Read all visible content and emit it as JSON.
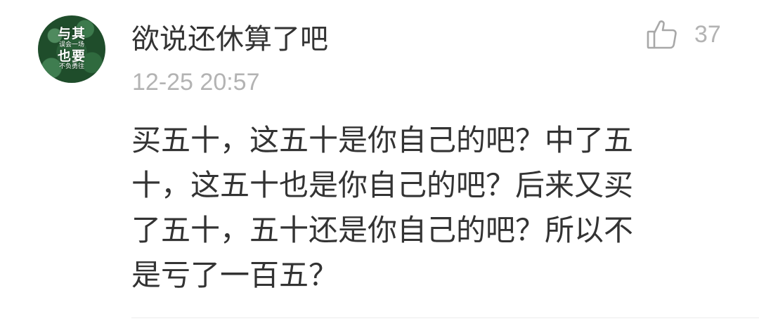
{
  "comment": {
    "avatar": {
      "line1": "与其",
      "line2": "误会一场",
      "line3": "也要",
      "line4": "不负勇往"
    },
    "username": "欲说还休算了吧",
    "timestamp": "12-25 20:57",
    "like": {
      "icon": "thumbs-up-icon",
      "count": "37"
    },
    "content_lines": [
      "买五十，这五十是你自己的吧？中了五",
      "十，这五十也是你自己的吧？后来又买",
      "了五十，五十还是你自己的吧？所以不",
      "是亏了一百五？"
    ]
  },
  "colors": {
    "text_primary": "#333333",
    "text_secondary": "#b3b3b3",
    "icon_gray": "#a8a8a8",
    "divider": "#ececec",
    "avatar_green": "#1f4d2b"
  }
}
